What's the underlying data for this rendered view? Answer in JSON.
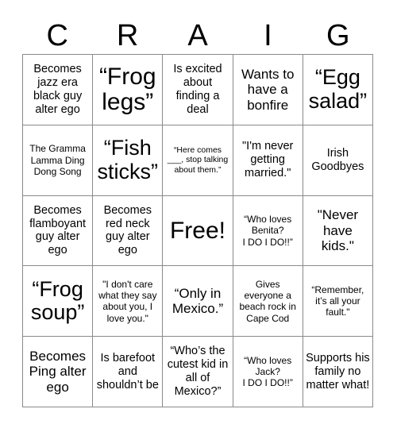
{
  "card": {
    "header_letters": [
      "C",
      "R",
      "A",
      "I",
      "G"
    ],
    "rows": [
      [
        {
          "text": "Becomes jazz era black guy alter ego",
          "size": "m"
        },
        {
          "text": "“Frog legs”",
          "size": "xxl"
        },
        {
          "text": "Is excited about finding a deal",
          "size": "m"
        },
        {
          "text": "Wants to have a bonfire",
          "size": "l"
        },
        {
          "text": "“Egg salad”",
          "size": "xl"
        }
      ],
      [
        {
          "text": "The Gramma Lamma Ding Dong Song",
          "size": "s"
        },
        {
          "text": "“Fish sticks”",
          "size": "xl"
        },
        {
          "text": "“Here comes ___, stop talking about them.”",
          "size": "xs"
        },
        {
          "text": "\"I'm never getting married.\"",
          "size": "m"
        },
        {
          "text": "Irish Goodbyes",
          "size": "m"
        }
      ],
      [
        {
          "text": "Becomes flamboyant guy alter ego",
          "size": "m"
        },
        {
          "text": "Becomes red neck guy alter ego",
          "size": "m"
        },
        {
          "text": "Free!",
          "size": "xxl"
        },
        {
          "text": "“Who loves Benita?\nI DO I DO!!”",
          "size": "s"
        },
        {
          "text": "\"Never have kids.\"",
          "size": "l"
        }
      ],
      [
        {
          "text": "“Frog soup”",
          "size": "xl"
        },
        {
          "text": "\"I don't care what they say about you, I love you.\"",
          "size": "s"
        },
        {
          "text": "“Only in Mexico.”",
          "size": "l"
        },
        {
          "text": "Gives everyone a beach rock in Cape Cod",
          "size": "s"
        },
        {
          "text": "“Remember, it’s all your fault.\"",
          "size": "s"
        }
      ],
      [
        {
          "text": "Becomes Ping alter ego",
          "size": "l"
        },
        {
          "text": "Is barefoot and shouldn’t be",
          "size": "m"
        },
        {
          "text": "“Who’s the cutest kid in all of Mexico?”",
          "size": "m"
        },
        {
          "text": "“Who loves Jack?\nI DO I DO!!”",
          "size": "s"
        },
        {
          "text": "Supports his family no matter what!",
          "size": "m"
        }
      ]
    ]
  }
}
